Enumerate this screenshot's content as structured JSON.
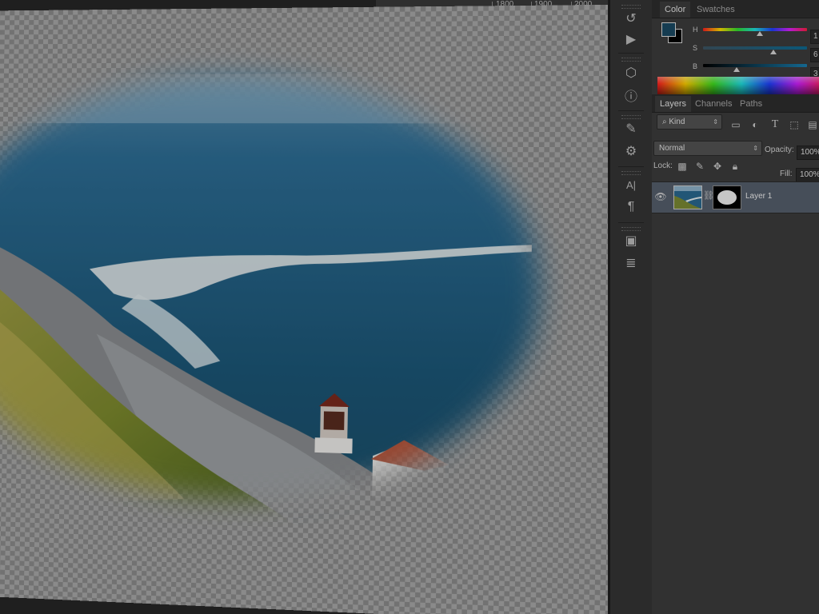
{
  "ruler": {
    "labels": [
      "1800",
      "1900",
      "2000"
    ]
  },
  "canvas": {
    "layer_content": "lighthouse-coastline-photo-with-oval-mask"
  },
  "tools": [
    {
      "name": "history-icon",
      "glyph": "↺"
    },
    {
      "name": "play-action-icon",
      "glyph": "▶"
    },
    {
      "name": "3d-cube-icon",
      "glyph": "⬡"
    },
    {
      "name": "info-icon",
      "glyph": "ⓘ"
    },
    {
      "name": "brush-presets-icon",
      "glyph": "✎"
    },
    {
      "name": "adjustments-icon",
      "glyph": "⚙"
    },
    {
      "name": "character-icon",
      "glyph": "A|"
    },
    {
      "name": "paragraph-icon",
      "glyph": "¶"
    },
    {
      "name": "layer-comps-icon",
      "glyph": "▣"
    },
    {
      "name": "notes-icon",
      "glyph": "≣"
    }
  ],
  "color_panel": {
    "tabs": [
      "Color",
      "Swatches"
    ],
    "active_tab": "Color",
    "foreground": "#1a4a63",
    "background": "#000000",
    "sliders": [
      {
        "label": "H",
        "value": "1"
      },
      {
        "label": "S",
        "value": "6"
      },
      {
        "label": "B",
        "value": "3"
      }
    ]
  },
  "layers_panel": {
    "tabs": [
      "Layers",
      "Channels",
      "Paths"
    ],
    "active_tab": "Layers",
    "filter_kind": "Kind",
    "filter_icons": [
      "image-filter-icon",
      "adjustment-filter-icon",
      "type-filter-icon",
      "shape-filter-icon",
      "smart-object-filter-icon"
    ],
    "blend_mode": "Normal",
    "opacity_label": "Opacity:",
    "opacity_value": "100%",
    "lock_label": "Lock:",
    "fill_label": "Fill:",
    "fill_value": "100%",
    "layers": [
      {
        "name": "Layer 1",
        "visible": true,
        "has_mask": true,
        "selected": true
      }
    ]
  }
}
